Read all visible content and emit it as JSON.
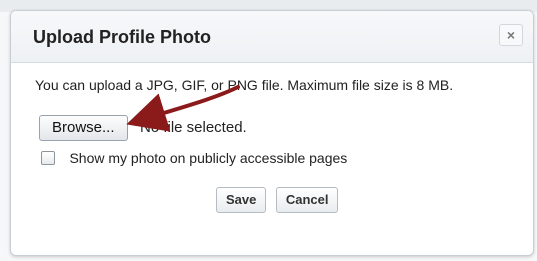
{
  "dialog": {
    "title": "Upload Profile Photo",
    "close_label": "×",
    "instructions": "You can upload a JPG, GIF, or PNG file. Maximum file size is 8 MB.",
    "browse_label": "Browse...",
    "file_status": "No file selected.",
    "public_checkbox_label": "Show my photo on publicly accessible pages",
    "public_checkbox_checked": false,
    "save_label": "Save",
    "cancel_label": "Cancel"
  },
  "annotation": {
    "arrow_color": "#8b1a1a",
    "target": "browse-button"
  },
  "icons": {
    "close": "close-icon",
    "arrow": "arrow-annotation-icon"
  }
}
